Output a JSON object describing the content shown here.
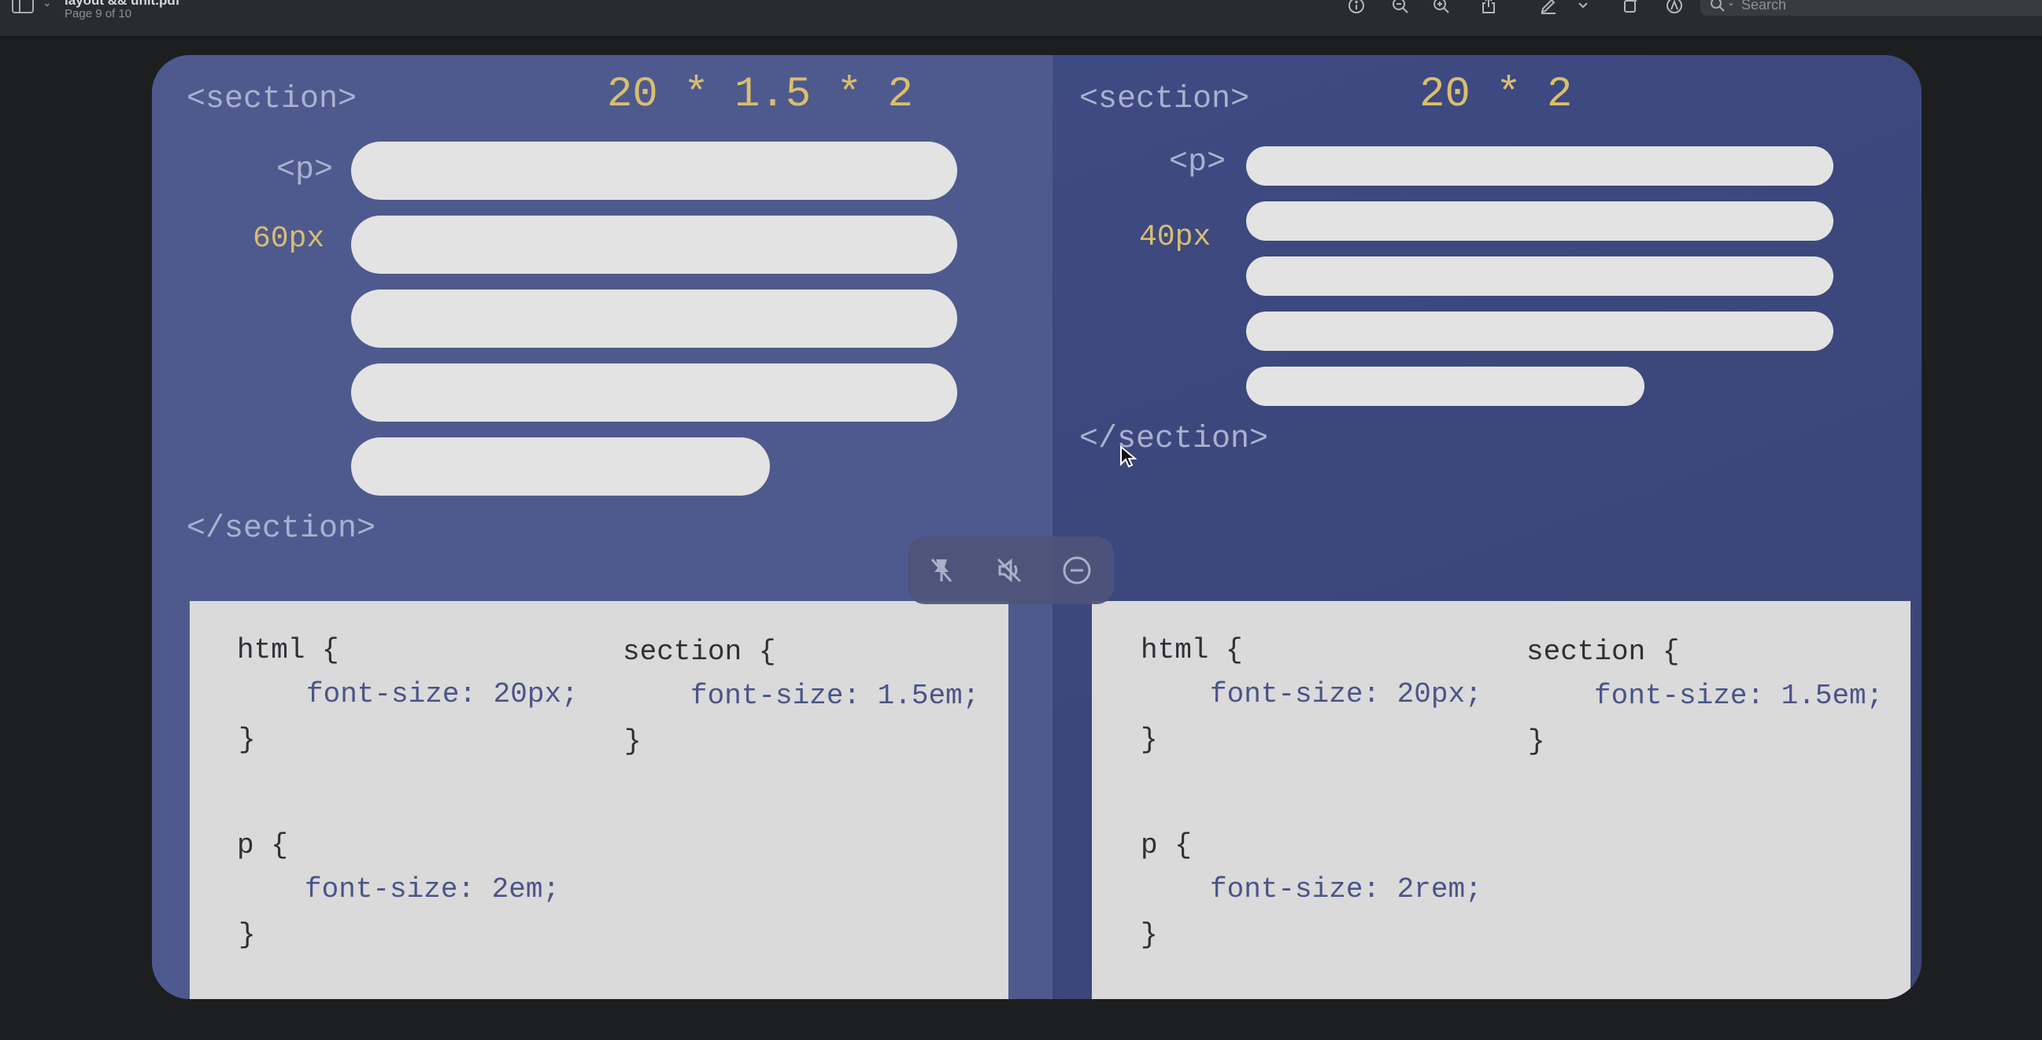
{
  "window": {
    "title": "layout && unit.pdf",
    "page_indicator": "Page 9 of 10"
  },
  "toolbar": {
    "icons": [
      "sidebar-icon",
      "info-icon",
      "zoom-out-icon",
      "zoom-in-icon",
      "share-icon",
      "highlight-icon",
      "chevron-down-icon",
      "rotate-icon",
      "markup-icon",
      "search-icon"
    ],
    "search_placeholder": "Search"
  },
  "slide": {
    "left": {
      "open_tag": "<section>",
      "formula": "20 * 1.5 * 2",
      "p_tag": "<p>",
      "size_label": "60px",
      "close_tag": "</section>",
      "code": {
        "html_open": "html {",
        "html_prop": "font-size: 20px;",
        "html_close": "}",
        "section_open": "section {",
        "section_prop": "font-size: 1.5em;",
        "section_close": "}",
        "p_open": "p {",
        "p_prop": "font-size: 2em;",
        "p_close": "}"
      }
    },
    "right": {
      "open_tag": "<section>",
      "formula": "20 * 2",
      "p_tag": "<p>",
      "size_label": "40px",
      "close_tag": "</section>",
      "code": {
        "html_open": "html {",
        "html_prop": "font-size: 20px;",
        "html_close": "}",
        "section_open": "section {",
        "section_prop": "font-size: 1.5em;",
        "section_close": "}",
        "p_open": "p {",
        "p_prop": "font-size: 2rem;",
        "p_close": "}"
      }
    }
  },
  "overlay_controls": [
    "unpin-icon",
    "mute-icon",
    "minimize-icon"
  ],
  "colors": {
    "slide_left": "#4e5a8e",
    "slide_right": "#3e4a82",
    "accent_yellow": "#d9be6e",
    "tag_text": "#aab1cf",
    "code_bg": "#dadada"
  }
}
